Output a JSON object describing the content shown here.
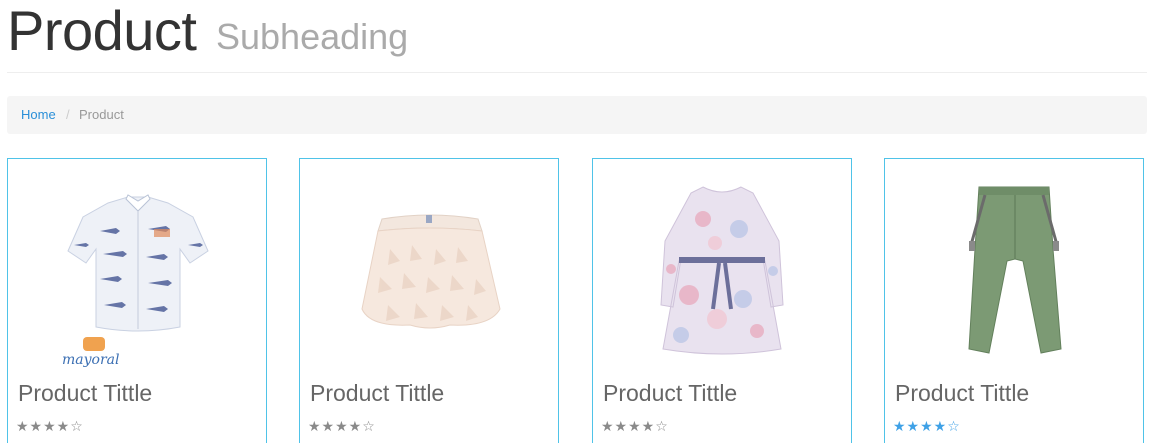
{
  "header": {
    "title": "Product",
    "subtitle": "Subheading"
  },
  "breadcrumb": {
    "home": "Home",
    "separator": "/",
    "current": "Product"
  },
  "colors": {
    "accent": "#4fc3e8",
    "link": "#2a8fd8",
    "rating_default": "#8a8a8a",
    "rating_highlight": "#3fa1e6"
  },
  "products": [
    {
      "title": "Product Tittle",
      "stars": "★★★★☆",
      "rating": 4,
      "image": "shirt-icon",
      "brand": "mayoral"
    },
    {
      "title": "Product Tittle",
      "stars": "★★★★☆",
      "rating": 4,
      "image": "skirt-icon"
    },
    {
      "title": "Product Tittle",
      "stars": "★★★★☆",
      "rating": 4,
      "image": "dress-icon"
    },
    {
      "title": "Product Tittle",
      "stars": "★★★★☆",
      "rating": 4,
      "image": "pants-icon"
    }
  ]
}
